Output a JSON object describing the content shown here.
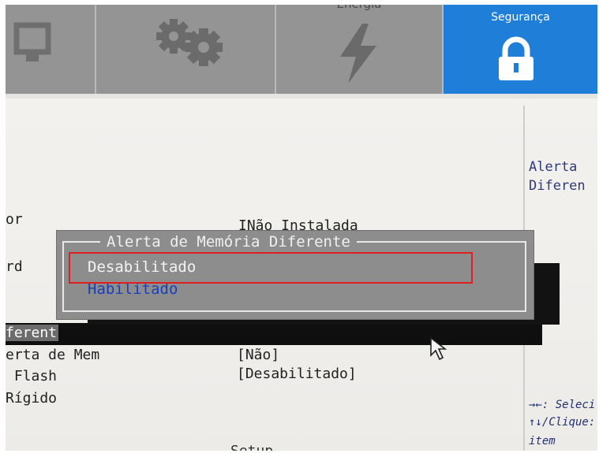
{
  "tabs": [
    {
      "label": "",
      "icon": "monitor-icon"
    },
    {
      "label": "",
      "icon": "gears-icon"
    },
    {
      "label": "Energia",
      "icon": "lightning-icon"
    },
    {
      "label": "Segurança",
      "icon": "lock-icon",
      "active": true
    }
  ],
  "help": {
    "line1": "Alerta",
    "line2": "Diferen",
    "keys1": "→←: Seleci",
    "keys2": "↑↓/Clique:",
    "keys3": "item"
  },
  "settings": [
    {
      "label": "or",
      "value": "INão Instalada"
    },
    {
      "label": "rd",
      "value": ""
    },
    {
      "label": "ferent",
      "value": ""
    },
    {
      "label": "erta de Mem",
      "value": "[Não]"
    },
    {
      "label": " Flash",
      "value": "[Desabilitado]"
    },
    {
      "label": "Rígido",
      "value": ""
    }
  ],
  "bottom_text": "Setup",
  "dialog": {
    "title": "Alerta de Memória Diferente",
    "options": [
      "Desabilitado",
      "Habilitado"
    ],
    "highlighted": "Desabilitado"
  },
  "colors": {
    "accent": "#1f7fd8",
    "annotation": "#e02020"
  }
}
